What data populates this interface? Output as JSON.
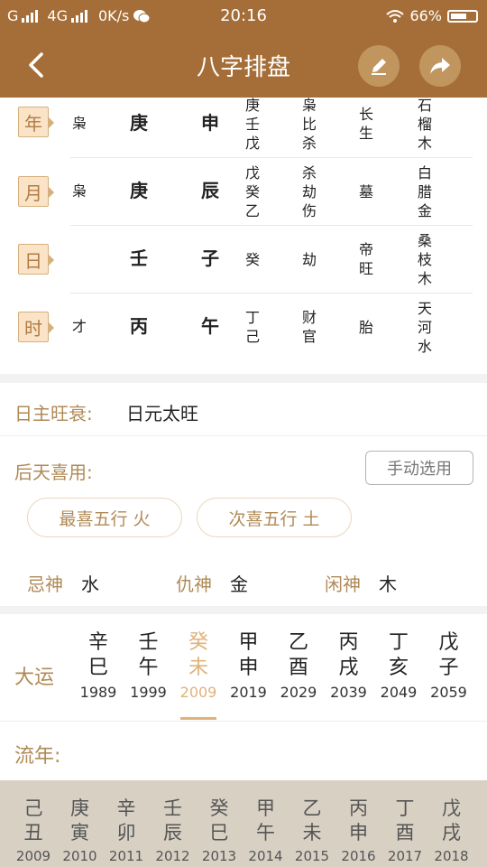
{
  "status_bar": {
    "carrier": "G",
    "network": "4G",
    "speed": "0K/s",
    "time": "20:16",
    "battery": "66%",
    "battery_level": 0.66
  },
  "header": {
    "title": "八字排盘"
  },
  "pillars": [
    {
      "tag": "年",
      "shishen": "枭",
      "gan": "庚",
      "zhi": "申",
      "canggan": [
        "庚",
        "壬",
        "戊"
      ],
      "fuxing": [
        "枭",
        "比",
        "杀"
      ],
      "state": [
        "长",
        "生"
      ],
      "nayin": [
        "石",
        "榴",
        "木"
      ]
    },
    {
      "tag": "月",
      "shishen": "枭",
      "gan": "庚",
      "zhi": "辰",
      "canggan": [
        "戊",
        "癸",
        "乙"
      ],
      "fuxing": [
        "杀",
        "劫",
        "伤"
      ],
      "state": [
        "墓"
      ],
      "nayin": [
        "白",
        "腊",
        "金"
      ]
    },
    {
      "tag": "日",
      "shishen": "",
      "gan": "壬",
      "zhi": "子",
      "canggan": [
        "癸"
      ],
      "fuxing": [
        "劫"
      ],
      "state": [
        "帝",
        "旺"
      ],
      "nayin": [
        "桑",
        "枝",
        "木"
      ]
    },
    {
      "tag": "时",
      "shishen": "才",
      "gan": "丙",
      "zhi": "午",
      "canggan": [
        "丁",
        "己"
      ],
      "fuxing": [
        "财",
        "官"
      ],
      "state": [
        "胎"
      ],
      "nayin": [
        "天",
        "河",
        "水"
      ]
    }
  ],
  "rizhu": {
    "label": "日主旺衰:",
    "value": "日元太旺"
  },
  "xiyong": {
    "label": "后天喜用:",
    "manual_button": "手动选用",
    "best": "最喜五行  火",
    "second": "次喜五行  土",
    "ji_label": "忌神",
    "ji_value": "水",
    "chou_label": "仇神",
    "chou_value": "金",
    "xian_label": "闲神",
    "xian_value": "木"
  },
  "dayun": {
    "label": "大运",
    "items": [
      {
        "gan": "辛",
        "zhi": "巳",
        "year": "1989"
      },
      {
        "gan": "壬",
        "zhi": "午",
        "year": "1999"
      },
      {
        "gan": "癸",
        "zhi": "未",
        "year": "2009"
      },
      {
        "gan": "甲",
        "zhi": "申",
        "year": "2019"
      },
      {
        "gan": "乙",
        "zhi": "酉",
        "year": "2029"
      },
      {
        "gan": "丙",
        "zhi": "戌",
        "year": "2039"
      },
      {
        "gan": "丁",
        "zhi": "亥",
        "year": "2049"
      },
      {
        "gan": "戊",
        "zhi": "子",
        "year": "2059"
      }
    ],
    "active_index": 2
  },
  "liunian": {
    "label": "流年:",
    "items": [
      {
        "gan": "己",
        "zhi": "丑",
        "year": "2009"
      },
      {
        "gan": "庚",
        "zhi": "寅",
        "year": "2010"
      },
      {
        "gan": "辛",
        "zhi": "卯",
        "year": "2011"
      },
      {
        "gan": "壬",
        "zhi": "辰",
        "year": "2012"
      },
      {
        "gan": "癸",
        "zhi": "巳",
        "year": "2013"
      },
      {
        "gan": "甲",
        "zhi": "午",
        "year": "2014"
      },
      {
        "gan": "乙",
        "zhi": "未",
        "year": "2015"
      },
      {
        "gan": "丙",
        "zhi": "申",
        "year": "2016"
      },
      {
        "gan": "丁",
        "zhi": "酉",
        "year": "2017"
      },
      {
        "gan": "戊",
        "zhi": "戌",
        "year": "2018"
      }
    ]
  },
  "colors": {
    "brand": "#a56e38",
    "gold": "#b08a56",
    "active": "#e0b27b"
  }
}
